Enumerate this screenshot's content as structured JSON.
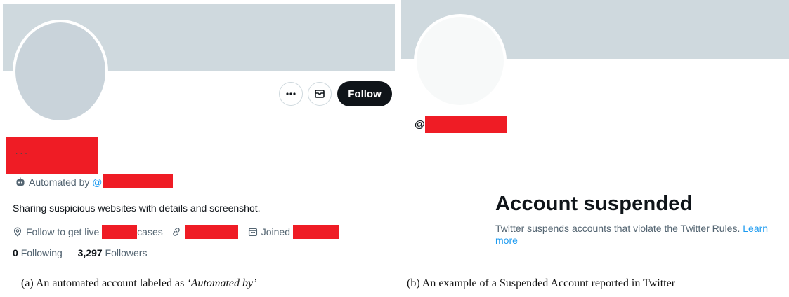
{
  "panel_a": {
    "buttons": {
      "follow_label": "Follow"
    },
    "automated": {
      "text": "Automated by",
      "at": "@"
    },
    "bio": "Sharing suspicious websites with details and screenshot.",
    "meta": {
      "location_prefix": "Follow to get live",
      "location_suffix": "cases",
      "joined_label": "Joined"
    },
    "stats": {
      "following_count": "0",
      "following_label": "Following",
      "followers_count": "3,297",
      "followers_label": "Followers"
    }
  },
  "panel_b": {
    "handle_at": "@",
    "title": "Account suspended",
    "description": "Twitter suspends accounts that violate the Twitter Rules.",
    "learn_more": "Learn more"
  },
  "captions": {
    "a_prefix": "(a) An automated account labeled as ",
    "a_italic": "‘Automated by’",
    "b": "(b) An example of a Suspended Account reported in Twitter"
  },
  "colors": {
    "banner": "#cfd9de",
    "redaction": "#ef1c25",
    "link": "#1d9bf0",
    "secondary_text": "#536471",
    "primary_text": "#0f1419"
  },
  "icons": [
    "more-icon",
    "mail-icon",
    "bot-icon",
    "location-icon",
    "link-icon",
    "calendar-icon"
  ]
}
